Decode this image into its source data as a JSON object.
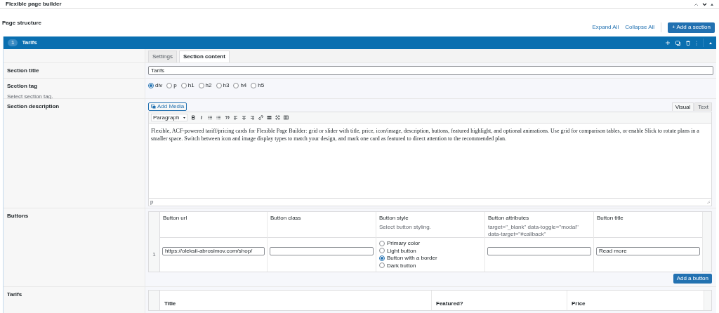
{
  "panel": {
    "title": "Flexible page builder"
  },
  "page_structure": {
    "label": "Page structure",
    "links": [
      "Expand All",
      "Collapse All"
    ],
    "add_button": "+ Add a section"
  },
  "section": {
    "number": "1",
    "title": "Tarifs",
    "expanded": true
  },
  "tabs": [
    {
      "label": "Settings",
      "selected": false
    },
    {
      "label": "Section content",
      "selected": true
    }
  ],
  "fields": [
    {
      "kind": "text",
      "label": "Section title",
      "value": "Tarifs"
    },
    {
      "kind": "radio",
      "label": "Section tag",
      "hint": "Select section tag.",
      "options": [
        {
          "label": "div",
          "selected": true
        },
        {
          "label": "p",
          "selected": false
        },
        {
          "label": "h1",
          "selected": false
        },
        {
          "label": "h2",
          "selected": false
        },
        {
          "label": "h3",
          "selected": false
        },
        {
          "label": "h4",
          "selected": false
        },
        {
          "label": "h5",
          "selected": false
        }
      ]
    },
    {
      "kind": "editor",
      "label": "Section description",
      "add_media": "Add Media",
      "modes": [
        {
          "label": "Visual",
          "selected": true
        },
        {
          "label": "Text",
          "selected": false
        }
      ],
      "format": "Paragraph",
      "content": "Flexible, ACF-powered tariff/pricing cards for Flexible Page Builder: grid or slider with title, price, icon/image, description, buttons, featured highlight, and optional animations. Use grid for comparison tables, or enable Slick to rotate plans in a smaller space. Switch between icon and image display types to match your design, and mark one card as featured to direct attention to the recommended plan.",
      "path": "p"
    },
    {
      "kind": "repeater",
      "label": "Buttons",
      "columns": [
        {
          "title": "Button url"
        },
        {
          "title": "Button class"
        },
        {
          "title": "Button style",
          "hint": "Select button styling."
        },
        {
          "title": "Button attributes",
          "hint": "target=\"_blank\" data-toggle=\"modal\" data-target=\"#callback\""
        },
        {
          "title": "Button title"
        }
      ],
      "rows": [
        {
          "number": "1",
          "url": "https://oleksii-abrosimov.com/shop/",
          "class": "",
          "styles": [
            {
              "label": "Primary color",
              "selected": false
            },
            {
              "label": "Light button",
              "selected": false
            },
            {
              "label": "Button with a border",
              "selected": true
            },
            {
              "label": "Dark button",
              "selected": false
            }
          ],
          "attributes": "",
          "title": "Read more"
        }
      ],
      "add_button": "Add a button"
    },
    {
      "kind": "table",
      "label": "Tarifs",
      "columns": [
        "Title",
        "Featured?",
        "Price"
      ]
    }
  ]
}
